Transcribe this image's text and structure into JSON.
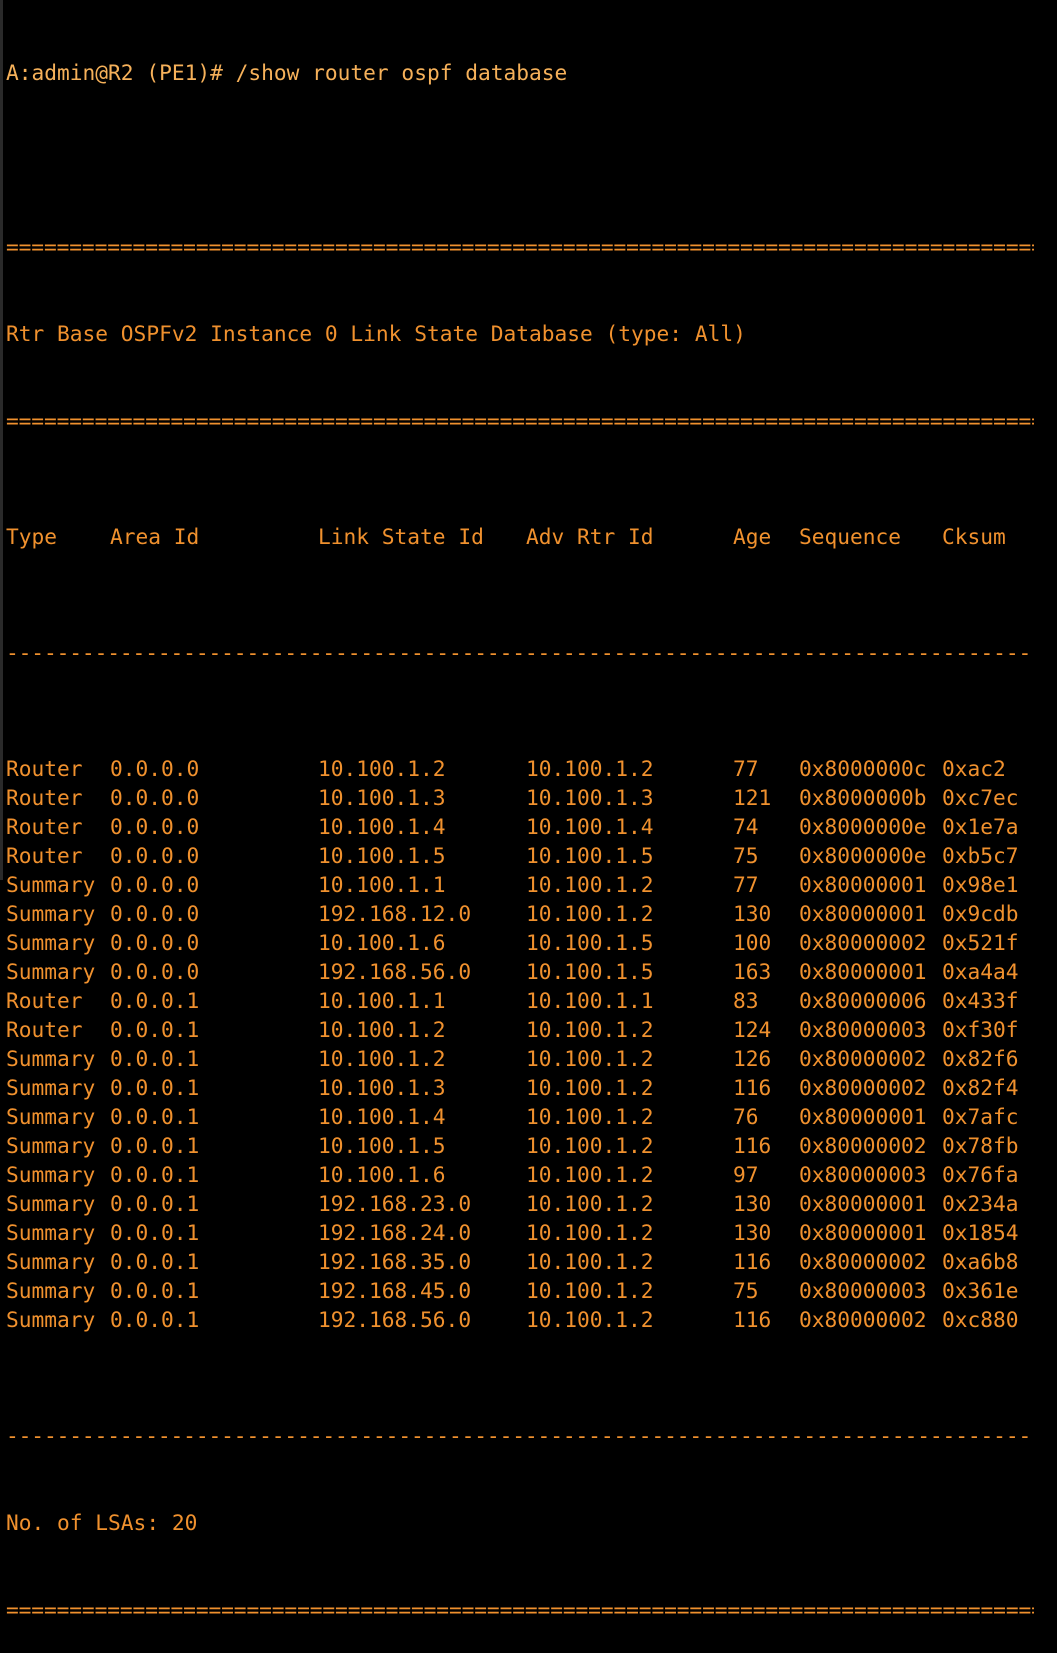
{
  "prompt": "A:admin@R2 (PE1)# /show router ospf database",
  "separators": {
    "double": "========================================================================================================",
    "single": "--------------------------------------------------------------------------------------------------------"
  },
  "title": "Rtr Base OSPFv2 Instance 0 Link State Database (type: All)",
  "columns": [
    "Type",
    "Area Id",
    "Link State Id",
    "Adv Rtr Id",
    "Age",
    "Sequence",
    "Cksum"
  ],
  "rows": [
    [
      "Router",
      "0.0.0.0",
      "10.100.1.2",
      "10.100.1.2",
      "77",
      "0x8000000c",
      "0xac2"
    ],
    [
      "Router",
      "0.0.0.0",
      "10.100.1.3",
      "10.100.1.3",
      "121",
      "0x8000000b",
      "0xc7ec"
    ],
    [
      "Router",
      "0.0.0.0",
      "10.100.1.4",
      "10.100.1.4",
      "74",
      "0x8000000e",
      "0x1e7a"
    ],
    [
      "Router",
      "0.0.0.0",
      "10.100.1.5",
      "10.100.1.5",
      "75",
      "0x8000000e",
      "0xb5c7"
    ],
    [
      "Summary",
      "0.0.0.0",
      "10.100.1.1",
      "10.100.1.2",
      "77",
      "0x80000001",
      "0x98e1"
    ],
    [
      "Summary",
      "0.0.0.0",
      "192.168.12.0",
      "10.100.1.2",
      "130",
      "0x80000001",
      "0x9cdb"
    ],
    [
      "Summary",
      "0.0.0.0",
      "10.100.1.6",
      "10.100.1.5",
      "100",
      "0x80000002",
      "0x521f"
    ],
    [
      "Summary",
      "0.0.0.0",
      "192.168.56.0",
      "10.100.1.5",
      "163",
      "0x80000001",
      "0xa4a4"
    ],
    [
      "Router",
      "0.0.0.1",
      "10.100.1.1",
      "10.100.1.1",
      "83",
      "0x80000006",
      "0x433f"
    ],
    [
      "Router",
      "0.0.0.1",
      "10.100.1.2",
      "10.100.1.2",
      "124",
      "0x80000003",
      "0xf30f"
    ],
    [
      "Summary",
      "0.0.0.1",
      "10.100.1.2",
      "10.100.1.2",
      "126",
      "0x80000002",
      "0x82f6"
    ],
    [
      "Summary",
      "0.0.0.1",
      "10.100.1.3",
      "10.100.1.2",
      "116",
      "0x80000002",
      "0x82f4"
    ],
    [
      "Summary",
      "0.0.0.1",
      "10.100.1.4",
      "10.100.1.2",
      "76",
      "0x80000001",
      "0x7afc"
    ],
    [
      "Summary",
      "0.0.0.1",
      "10.100.1.5",
      "10.100.1.2",
      "116",
      "0x80000002",
      "0x78fb"
    ],
    [
      "Summary",
      "0.0.0.1",
      "10.100.1.6",
      "10.100.1.2",
      "97",
      "0x80000003",
      "0x76fa"
    ],
    [
      "Summary",
      "0.0.0.1",
      "192.168.23.0",
      "10.100.1.2",
      "130",
      "0x80000001",
      "0x234a"
    ],
    [
      "Summary",
      "0.0.0.1",
      "192.168.24.0",
      "10.100.1.2",
      "130",
      "0x80000001",
      "0x1854"
    ],
    [
      "Summary",
      "0.0.0.1",
      "192.168.35.0",
      "10.100.1.2",
      "116",
      "0x80000002",
      "0xa6b8"
    ],
    [
      "Summary",
      "0.0.0.1",
      "192.168.45.0",
      "10.100.1.2",
      "75",
      "0x80000003",
      "0x361e"
    ],
    [
      "Summary",
      "0.0.0.1",
      "192.168.56.0",
      "10.100.1.2",
      "116",
      "0x80000002",
      "0xc880"
    ]
  ],
  "footer": "No. of LSAs: 20",
  "colors": {
    "background": "#000000",
    "text": "#f0912e",
    "prompt": "#f6b15a"
  }
}
